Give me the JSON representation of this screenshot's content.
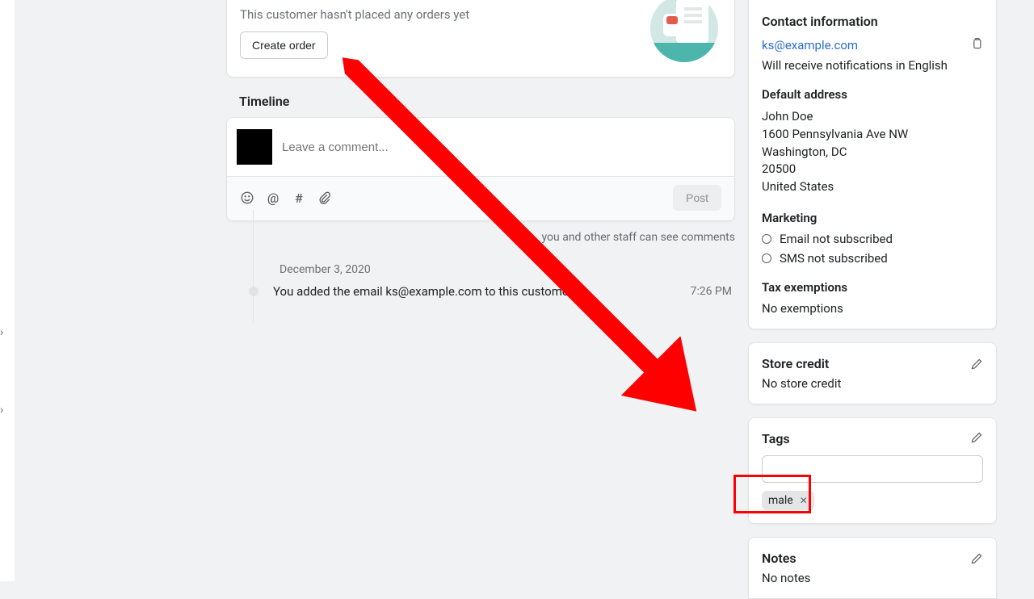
{
  "lastOrder": {
    "message": "This customer hasn't placed any orders yet",
    "button": "Create order"
  },
  "timeline": {
    "heading": "Timeline",
    "placeholder": "Leave a comment...",
    "post": "Post",
    "visibilityNote": "you and other staff can see comments",
    "date": "December 3, 2020",
    "eventText": "You added the email ks@example.com to this customer.",
    "eventTime": "7:26 PM"
  },
  "contact": {
    "heading": "Contact information",
    "email": "ks@example.com",
    "langNote": "Will receive notifications in English",
    "defaultAddressHeading": "Default address",
    "address": {
      "name": "John Doe",
      "line1": "1600 Pennsylvania Ave NW",
      "cityState": "Washington, DC",
      "postal": "20500",
      "country": "United States"
    },
    "marketingHeading": "Marketing",
    "emailStatus": "Email not subscribed",
    "smsStatus": "SMS not subscribed",
    "taxHeading": "Tax exemptions",
    "taxValue": "No exemptions"
  },
  "storeCredit": {
    "heading": "Store credit",
    "value": "No store credit"
  },
  "tags": {
    "heading": "Tags",
    "chip": "male"
  },
  "notes": {
    "heading": "Notes",
    "value": "No notes"
  }
}
